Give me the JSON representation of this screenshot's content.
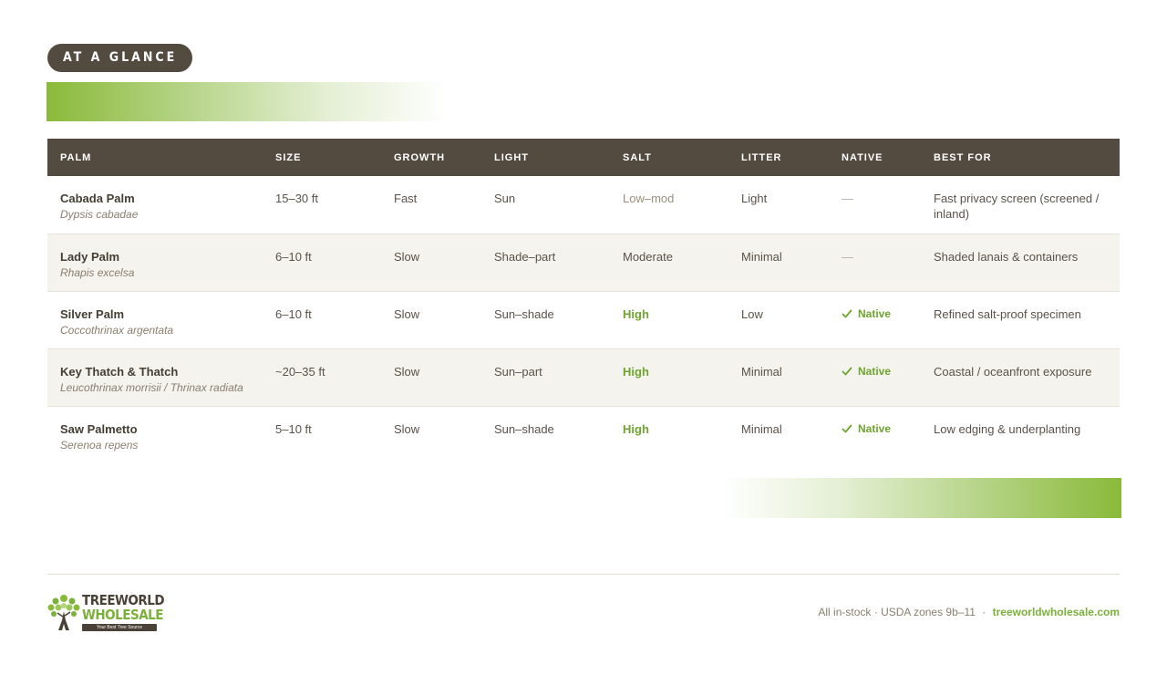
{
  "badge": "AT A GLANCE",
  "colors": {
    "brand_dark": "#544b40",
    "brand_green": "#7bb03a",
    "accent_green": "#8aba3a"
  },
  "table": {
    "headers": [
      "PALM",
      "SIZE",
      "GROWTH",
      "LIGHT",
      "SALT",
      "LITTER",
      "NATIVE",
      "BEST FOR"
    ],
    "rows": [
      {
        "name": "Cabada Palm",
        "scientific": "Dypsis cabadae",
        "size": "15–30 ft",
        "growth": "Fast",
        "light": "Sun",
        "salt": "Low–mod",
        "salt_level": "low",
        "litter": "Light",
        "native": "—",
        "native_flag": false,
        "best_for": "Fast privacy screen (screened / inland)"
      },
      {
        "name": "Lady Palm",
        "scientific": "Rhapis excelsa",
        "size": "6–10 ft",
        "growth": "Slow",
        "light": "Shade–part",
        "salt": "Moderate",
        "salt_level": "moderate",
        "litter": "Minimal",
        "native": "—",
        "native_flag": false,
        "best_for": "Shaded lanais & containers"
      },
      {
        "name": "Silver Palm",
        "scientific": "Coccothrinax argentata",
        "size": "6–10 ft",
        "growth": "Slow",
        "light": "Sun–shade",
        "salt": "High",
        "salt_level": "high",
        "litter": "Low",
        "native": "Native",
        "native_flag": true,
        "best_for": "Refined salt-proof specimen"
      },
      {
        "name": "Key Thatch & Thatch",
        "scientific": "Leucothrinax morrisii / Thrinax radiata",
        "size": "~20–35 ft",
        "growth": "Slow",
        "light": "Sun–part",
        "salt": "High",
        "salt_level": "high",
        "litter": "Minimal",
        "native": "Native",
        "native_flag": true,
        "best_for": "Coastal / oceanfront exposure"
      },
      {
        "name": "Saw Palmetto",
        "scientific": "Serenoa repens",
        "size": "5–10 ft",
        "growth": "Slow",
        "light": "Sun–shade",
        "salt": "High",
        "salt_level": "high",
        "litter": "Minimal",
        "native": "Native",
        "native_flag": true,
        "best_for": "Low edging & underplanting"
      }
    ]
  },
  "logo": {
    "line1": "TREEWORLD",
    "line2": "WHOLESALE",
    "tagline": "Your Best Tree Source"
  },
  "footer": {
    "note": "All in-stock · USDA zones 9b–11",
    "separator": "·",
    "link": "treeworldwholesale.com"
  }
}
